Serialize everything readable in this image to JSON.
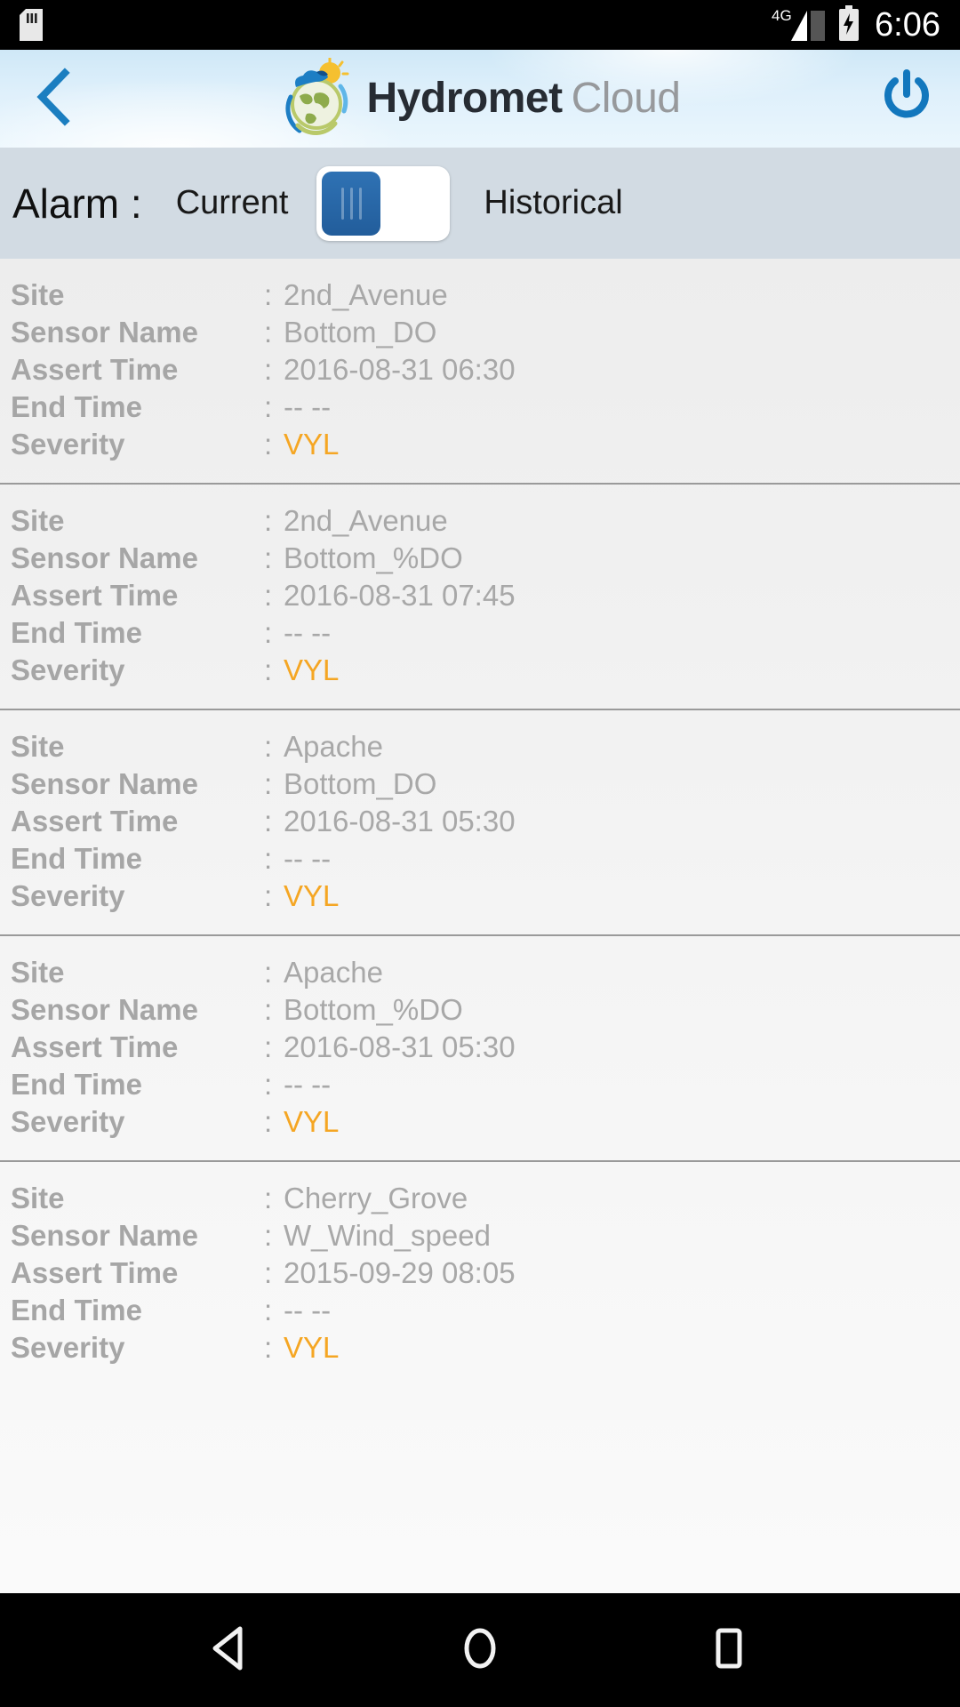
{
  "statusbar": {
    "sd_icon": "sd-card-icon",
    "network_label": "4G",
    "signal_icon": "signal-bars-icon",
    "battery_icon": "battery-charging-icon",
    "time": "6:06"
  },
  "header": {
    "back_icon": "chevron-left-icon",
    "logo_icon": "hydromet-globe-logo-icon",
    "brand_primary": "Hydromet",
    "brand_secondary": "Cloud",
    "power_icon": "power-icon"
  },
  "filterbar": {
    "title": "Alarm :",
    "option_left": "Current",
    "option_right": "Historical",
    "toggle_state": "left",
    "toggle_icon": "toggle-switch-icon",
    "accent_color": "#2f72b4",
    "bar_color": "#d2dbe3"
  },
  "list": {
    "labels": {
      "site": "Site",
      "sensor_name": "Sensor Name",
      "assert_time": "Assert Time",
      "end_time": "End Time",
      "severity": "Severity"
    },
    "separator": ":",
    "severity_color": "#f5a623",
    "records": [
      {
        "site": "2nd_Avenue",
        "sensor_name": "Bottom_DO",
        "assert_time": "2016-08-31 06:30",
        "end_time": "-- --",
        "severity": "VYL"
      },
      {
        "site": "2nd_Avenue",
        "sensor_name": "Bottom_%DO",
        "assert_time": "2016-08-31 07:45",
        "end_time": "-- --",
        "severity": "VYL"
      },
      {
        "site": "Apache",
        "sensor_name": "Bottom_DO",
        "assert_time": "2016-08-31 05:30",
        "end_time": "-- --",
        "severity": "VYL"
      },
      {
        "site": "Apache",
        "sensor_name": "Bottom_%DO",
        "assert_time": "2016-08-31 05:30",
        "end_time": "-- --",
        "severity": "VYL"
      },
      {
        "site": "Cherry_Grove",
        "sensor_name": "W_Wind_speed",
        "assert_time": "2015-09-29 08:05",
        "end_time": "-- --",
        "severity": "VYL"
      }
    ]
  },
  "navbar": {
    "back_icon": "nav-back-triangle-icon",
    "home_icon": "nav-home-circle-icon",
    "recents_icon": "nav-recents-square-icon"
  }
}
